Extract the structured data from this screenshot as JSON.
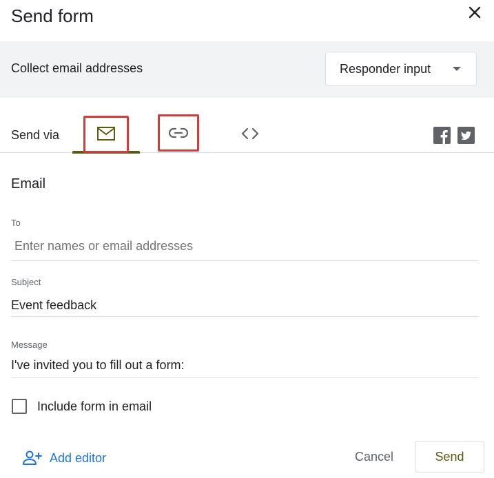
{
  "dialog": {
    "title": "Send form",
    "close_icon": "close-icon"
  },
  "collect": {
    "label": "Collect email addresses",
    "select_value": "Responder input",
    "dropdown_icon": "arrow-drop-down-icon"
  },
  "send_via": {
    "label": "Send via",
    "tabs": [
      {
        "icon": "email-icon",
        "selected": true
      },
      {
        "icon": "link-icon",
        "selected": false
      },
      {
        "icon": "embed-code-icon",
        "selected": false
      }
    ],
    "social": [
      {
        "icon": "facebook-icon"
      },
      {
        "icon": "twitter-icon"
      }
    ]
  },
  "email": {
    "heading": "Email",
    "to_label": "To",
    "to_placeholder": "Enter names or email addresses",
    "subject_label": "Subject",
    "subject_value": "Event feedback",
    "message_label": "Message",
    "message_value": "I've invited you to fill out a form:",
    "include_form_label": "Include form in email"
  },
  "footer": {
    "add_editor_label": "Add editor",
    "add_editor_icon": "person-add-icon",
    "cancel_label": "Cancel",
    "send_label": "Send"
  },
  "colors": {
    "accent": "#5a5b0f",
    "link_blue": "#1a73e8",
    "highlight_red": "#d23c3c",
    "bar_gray": "#f1f3f4"
  }
}
